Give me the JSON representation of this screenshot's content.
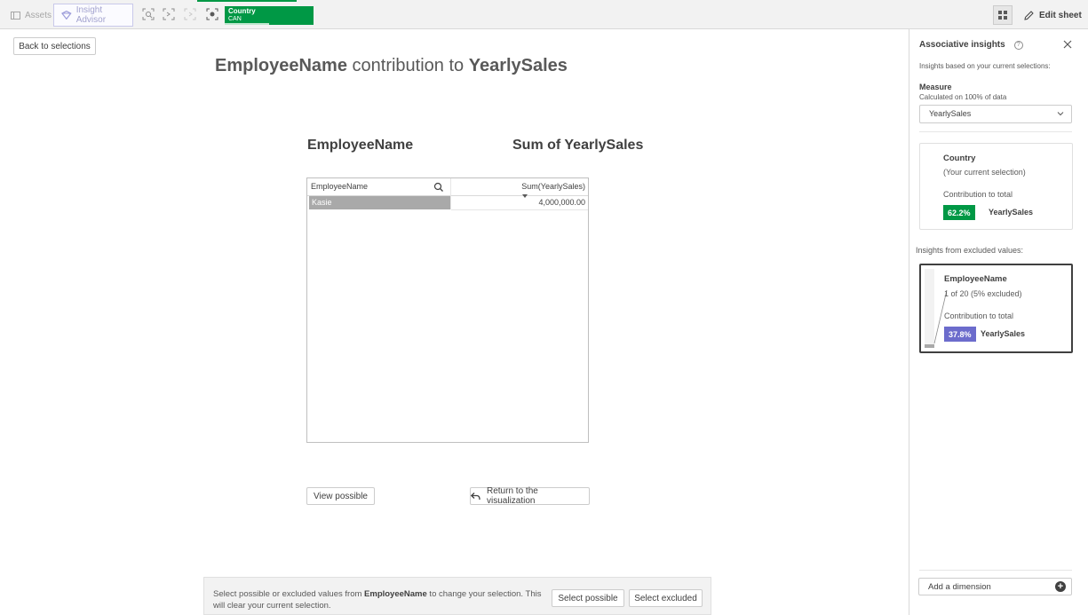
{
  "toolbar": {
    "assets_label": "Assets",
    "insight_label": "Insight Advisor",
    "selection": {
      "field": "Country",
      "value": "CAN"
    },
    "edit_sheet_label": "Edit sheet",
    "colors": {
      "selection_green": "#009845",
      "insight_purple": "#a3a3cf"
    }
  },
  "main": {
    "back_label": "Back to selections",
    "title": {
      "dimension": "EmployeeName",
      "middle": " contribution to ",
      "measure": "YearlySales"
    },
    "col_dimension": "EmployeeName",
    "col_measure": "Sum of YearlySales",
    "table": {
      "header_dimension": "EmployeeName",
      "header_measure": "Sum(YearlySales)",
      "rows": [
        {
          "name": "Kasie",
          "value": "4,000,000.00"
        }
      ]
    },
    "view_possible_label": "View possible",
    "return_label": "Return to the visualization"
  },
  "bottom": {
    "msg_pre": "Select possible or excluded values from ",
    "msg_field": "EmployeeName",
    "msg_post": " to change your selection. This will clear your current selection.",
    "select_possible_label": "Select possible",
    "select_excluded_label": "Select excluded"
  },
  "panel": {
    "title": "Associative insights",
    "subtitle": "Insights based on your current selections:",
    "measure_label": "Measure",
    "calc_label": "Calculated on 100% of data",
    "measure_value": "YearlySales",
    "country_card": {
      "heading": "Country",
      "sub": "(Your current selection)",
      "contribution_label": "Contribution to total",
      "percent": "62.2%",
      "measure": "YearlySales"
    },
    "excluded_title": "Insights from excluded values:",
    "employee_card": {
      "heading": "EmployeeName",
      "sub": "1 of 20 (5% excluded)",
      "contribution_label": "Contribution to total",
      "percent": "37.8%",
      "measure": "YearlySales",
      "included_fraction": 0.05
    },
    "add_dimension_label": "Add a dimension"
  }
}
